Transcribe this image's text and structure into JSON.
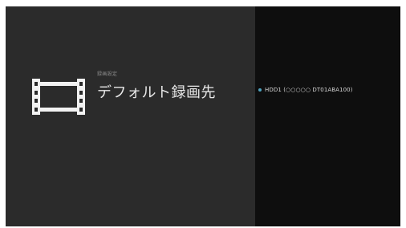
{
  "header": {
    "breadcrumb": "録画設定",
    "title": "デフォルト録画先"
  },
  "icons": {
    "category_icon": "film-strip-icon",
    "selected_indicator": "radio-selected-icon"
  },
  "options": [
    {
      "label": "HDD1 (○○○○○ DT01ABA100)",
      "selected": true
    }
  ],
  "colors": {
    "left_panel": "#2b2b2b",
    "right_panel": "#0e0e0e",
    "accent": "#4fa3c0"
  }
}
